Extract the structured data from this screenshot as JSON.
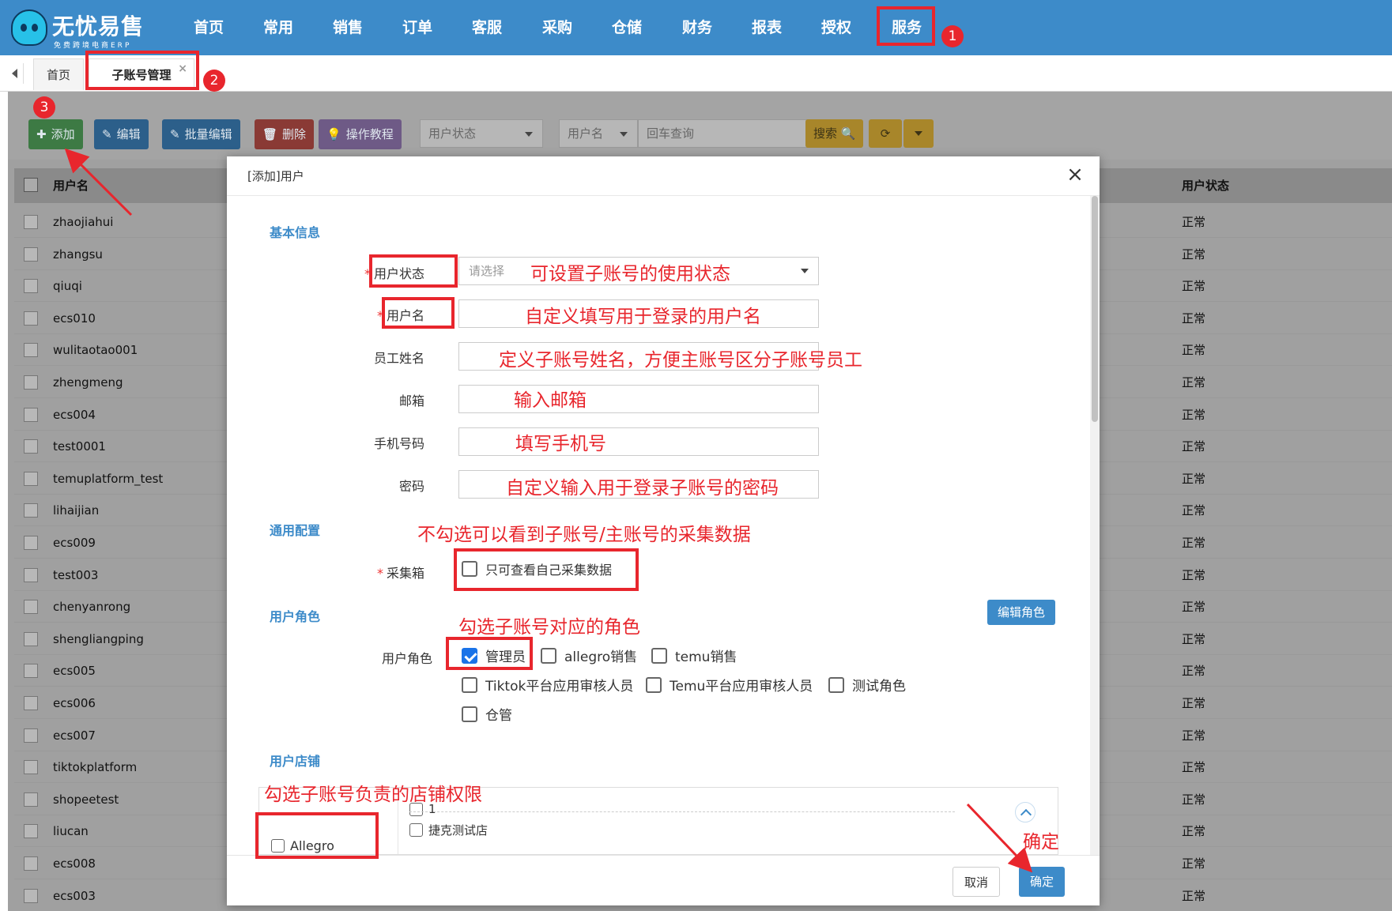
{
  "logo": {
    "title": "无忧易售",
    "subtitle": "免费跨境电商ERP"
  },
  "nav": [
    "首页",
    "常用",
    "销售",
    "订单",
    "客服",
    "采购",
    "仓储",
    "财务",
    "报表",
    "授权",
    "服务"
  ],
  "tabs": {
    "home": "首页",
    "active": "子账号管理",
    "close": "×"
  },
  "toolbar": {
    "add": "添加",
    "edit": "编辑",
    "batch_edit": "批量编辑",
    "delete": "删除",
    "tutorial": "操作教程",
    "status_filter": "用户状态",
    "search_field": "用户名",
    "search_placeholder": "回车查询",
    "search_btn": "搜索"
  },
  "table": {
    "col_username": "用户名",
    "col_status": "用户状态",
    "rows": [
      {
        "username": "zhaojiahui",
        "status": "正常"
      },
      {
        "username": "zhangsu",
        "status": "正常"
      },
      {
        "username": "qiuqi",
        "status": "正常"
      },
      {
        "username": "ecs010",
        "status": "正常"
      },
      {
        "username": "wulitaotao001",
        "status": "正常"
      },
      {
        "username": "zhengmeng",
        "status": "正常"
      },
      {
        "username": "ecs004",
        "status": "正常"
      },
      {
        "username": "test0001",
        "status": "正常"
      },
      {
        "username": "temuplatform_test",
        "status": "正常"
      },
      {
        "username": "lihaijian",
        "status": "正常"
      },
      {
        "username": "ecs009",
        "status": "正常"
      },
      {
        "username": "test003",
        "status": "正常"
      },
      {
        "username": "chenyanrong",
        "status": "正常"
      },
      {
        "username": "shengliangping",
        "status": "正常"
      },
      {
        "username": "ecs005",
        "status": "正常"
      },
      {
        "username": "ecs006",
        "status": "正常"
      },
      {
        "username": "ecs007",
        "status": "正常"
      },
      {
        "username": "tiktokplatform",
        "status": "正常"
      },
      {
        "username": "shopeetest",
        "status": "正常"
      },
      {
        "username": "liucan",
        "status": "正常"
      },
      {
        "username": "ecs008",
        "status": "正常"
      },
      {
        "username": "ecs003",
        "status": "正常"
      }
    ]
  },
  "modal": {
    "title": "[添加]用户",
    "close": "×",
    "section_basic": "基本信息",
    "user_status_label": "用户状态",
    "user_status_placeholder": "请选择",
    "username_label": "用户名",
    "employee_name_label": "员工姓名",
    "email_label": "邮箱",
    "phone_label": "手机号码",
    "password_label": "密码",
    "section_general": "通用配置",
    "collect_label": "采集箱",
    "collect_option": "只可查看自己采集数据",
    "section_role": "用户角色",
    "edit_role_btn": "编辑角色",
    "role_label": "用户角色",
    "roles": [
      {
        "name": "管理员",
        "checked": true
      },
      {
        "name": "allegro销售",
        "checked": false
      },
      {
        "name": "temu销售",
        "checked": false
      },
      {
        "name": "Tiktok平台应用审核人员",
        "checked": false
      },
      {
        "name": "Temu平台应用审核人员",
        "checked": false
      },
      {
        "name": "测试角色",
        "checked": false
      },
      {
        "name": "仓管",
        "checked": false
      }
    ],
    "section_store": "用户店铺",
    "store_platform": "Allegro",
    "stores": [
      "1",
      "捷克测试店"
    ],
    "cancel": "取消",
    "confirm": "确定"
  },
  "annotations": {
    "num1": "1",
    "num2": "2",
    "num3": "3",
    "status_note": "可设置子账号的使用状态",
    "username_note": "自定义填写用于登录的用户名",
    "employee_note": "定义子账号姓名，方便主账号区分子账号员工",
    "email_note": "输入邮箱",
    "phone_note": "填写手机号",
    "password_note": "自定义输入用于登录子账号的密码",
    "collect_note": "不勾选可以看到子账号/主账号的采集数据",
    "role_note": "勾选子账号对应的角色",
    "store_note": "勾选子账号负责的店铺权限",
    "confirm_note": "确定"
  },
  "colors": {
    "nav_bg": "#3d8bc9",
    "annotation": "#e8262d",
    "primary": "#3d8bc9",
    "checkbox_checked": "#1a73e8"
  }
}
